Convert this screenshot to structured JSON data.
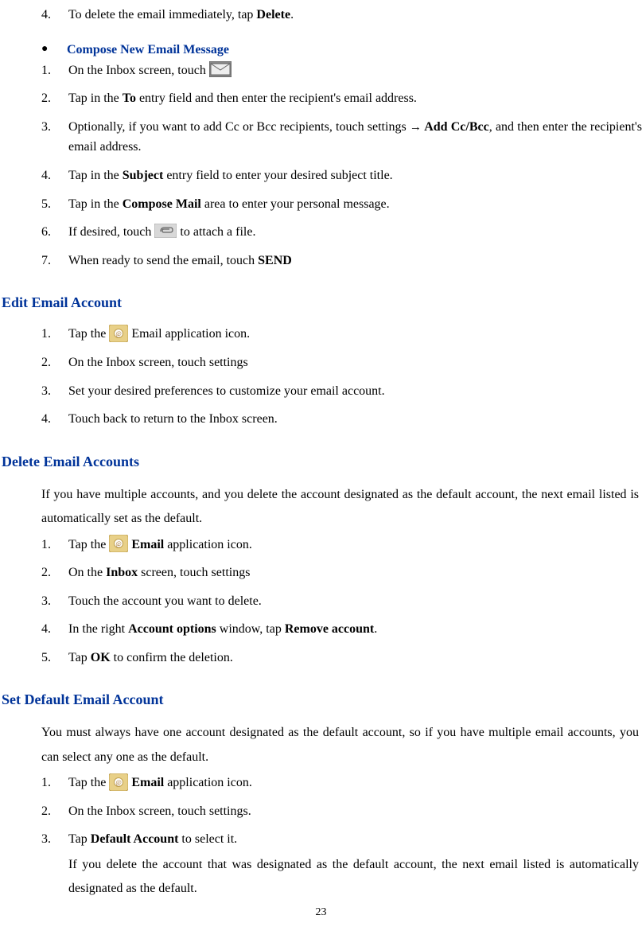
{
  "top_item4_num": "4.",
  "top_item4_prefix": "To delete the email immediately, tap ",
  "top_item4_bold": "Delete",
  "top_item4_suffix": ".",
  "compose_bullet": "●",
  "compose_heading": "Compose New Email Message",
  "compose": {
    "i1_num": "1.",
    "i1_text": "On the Inbox screen, touch ",
    "i2_num": "2.",
    "i2_prefix": "Tap in the ",
    "i2_bold": "To",
    "i2_suffix": " entry field and then enter the recipient's email address.",
    "i3_num": "3.",
    "i3_prefix": "Optionally, if you want to add Cc or Bcc recipients, touch settings ",
    "i3_arrow": "→",
    "i3_bold": " Add Cc/Bcc",
    "i3_suffix": ", and then enter the recipient's email address.",
    "i4_num": "4.",
    "i4_prefix": "Tap in the ",
    "i4_bold": "Subject",
    "i4_suffix": " entry field to enter your desired subject title.",
    "i5_num": "5.",
    "i5_prefix": "Tap in the ",
    "i5_bold": "Compose Mail",
    "i5_suffix": " area to enter your personal message.",
    "i6_num": "6.",
    "i6_prefix": "If desired, touch",
    "i6_suffix": " to attach a file.",
    "i7_num": "7.",
    "i7_prefix": "When ready to send the email, touch ",
    "i7_bold": "SEND"
  },
  "edit_heading": "Edit Email Account",
  "edit": {
    "i1_num": "1.",
    "i1_prefix": "Tap the ",
    "i1_suffix": " Email application icon.",
    "i2_num": "2.",
    "i2_text": "On the Inbox screen, touch settings",
    "i3_num": "3.",
    "i3_text": "Set your desired preferences to customize your email account.",
    "i4_num": "4.",
    "i4_text": "Touch back to return to the Inbox screen."
  },
  "delete_heading": "Delete Email Accounts",
  "delete_intro": "If you have multiple accounts, and you delete the account designated as the default account, the next email listed is automatically set as the default.",
  "delete": {
    "i1_num": "1.",
    "i1_prefix": "Tap the ",
    "i1_bold": " Email",
    "i1_suffix": " application icon.",
    "i2_num": "2.",
    "i2_prefix": "On the ",
    "i2_bold": "Inbox",
    "i2_suffix": " screen, touch settings",
    "i3_num": "3.",
    "i3_text": "Touch the account you want to delete.",
    "i4_num": "4.",
    "i4_prefix": "In the right ",
    "i4_bold1": "Account options",
    "i4_mid": " window, tap ",
    "i4_bold2": "Remove account",
    "i4_suffix": ".",
    "i5_num": "5.",
    "i5_prefix": "Tap ",
    "i5_bold": "OK",
    "i5_suffix": " to confirm the deletion."
  },
  "default_heading": "Set Default Email Account",
  "default_intro": "You must always have one account designated as the default account, so if you have multiple email accounts, you can select any one as the default.",
  "default": {
    "i1_num": "1.",
    "i1_prefix": "Tap the ",
    "i1_bold": " Email",
    "i1_suffix": " application icon.",
    "i2_num": "2.",
    "i2_text": "On the Inbox screen, touch settings.",
    "i3_num": "3.",
    "i3_prefix": "Tap ",
    "i3_bold": "Default Account",
    "i3_suffix": " to select it."
  },
  "default_note": "If you delete the account that was designated as the default account, the next email listed is automatically designated as the default.",
  "page_number": "23"
}
